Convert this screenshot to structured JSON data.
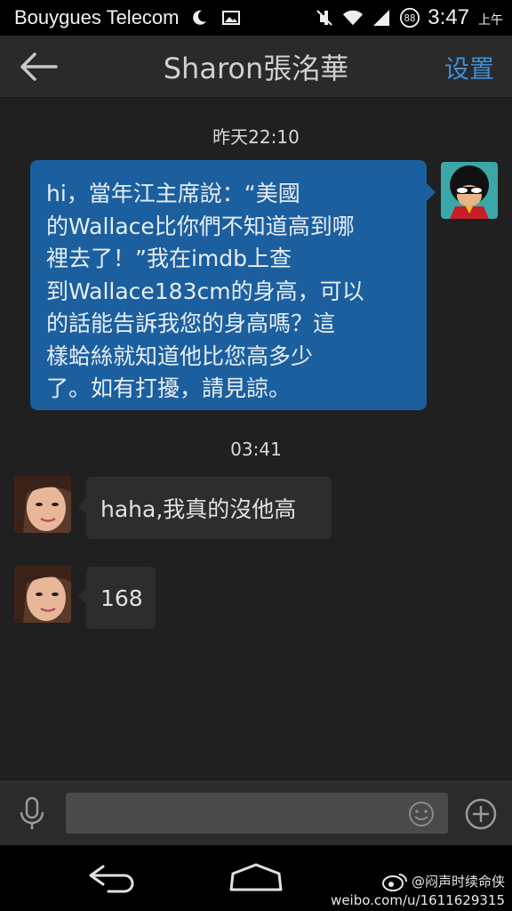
{
  "status_bar": {
    "carrier": "Bouygues Telecom",
    "time": "3:47",
    "ampm": "上午",
    "battery": "88",
    "icons": [
      "moon-icon",
      "image-icon",
      "mute-icon",
      "wifi-icon",
      "signal-icon",
      "battery-icon"
    ]
  },
  "header": {
    "title": "Sharon張洺華",
    "settings_label": "设置",
    "back_icon": "arrow-left-icon"
  },
  "messages": [
    {
      "type": "timestamp",
      "text": "昨天22:10"
    },
    {
      "type": "outgoing",
      "lines": [
        "hi，當年江主席說：“美國",
        "的Wallace比你們不知道高到哪",
        "裡去了！”我在imdb上查",
        "到Wallace183cm的身高，可以",
        "的話能告訴我您的身高嗎？這",
        "樣蛤絲就知道他比您高多少",
        "了。如有打擾，請見諒。"
      ]
    },
    {
      "type": "timestamp",
      "text": "03:41"
    },
    {
      "type": "incoming",
      "text": "haha,我真的沒他高"
    },
    {
      "type": "incoming",
      "text": "168"
    }
  ],
  "input_bar": {
    "placeholder": "",
    "icons": [
      "microphone-icon",
      "emoji-icon",
      "plus-icon"
    ]
  },
  "nav_bar": {
    "icons": [
      "nav-back-icon",
      "nav-home-icon"
    ]
  },
  "watermark": {
    "handle": "@闷声时续命侠",
    "url": "weibo.com/u/1611629315"
  },
  "colors": {
    "accent": "#3f8fd6",
    "outgoing_bubble": "#1c5f9f",
    "incoming_bubble": "#2d2d2d"
  }
}
